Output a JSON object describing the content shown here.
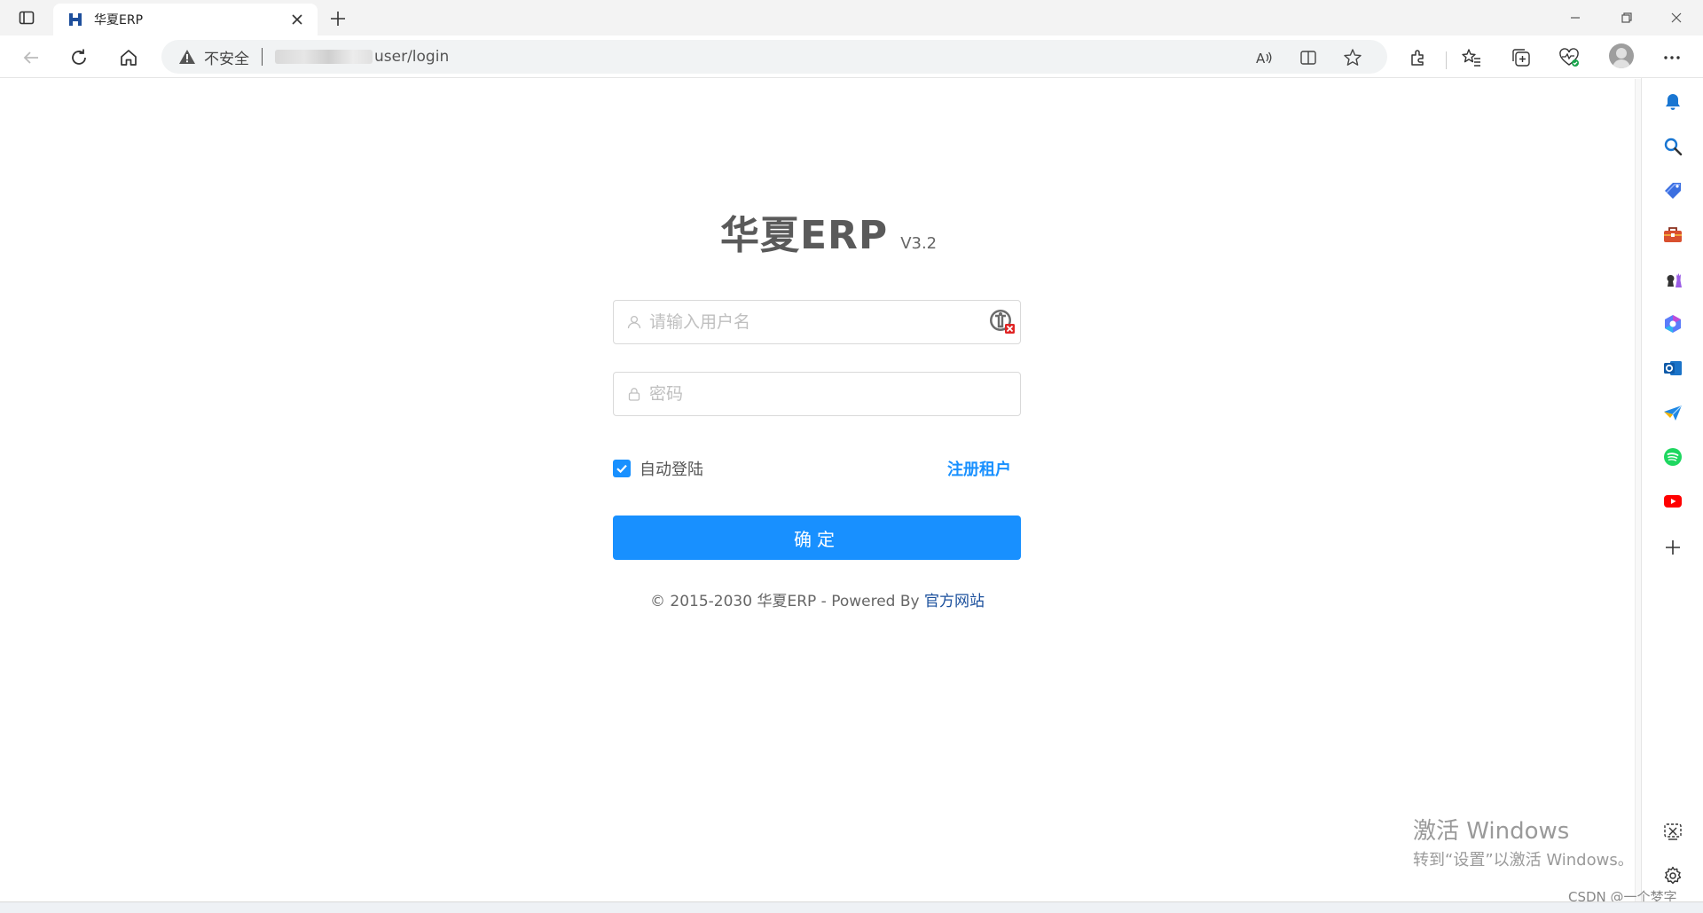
{
  "browser": {
    "tab_title": "华夏ERP",
    "address": {
      "security_label": "不安全",
      "url_path": "user/login"
    }
  },
  "login": {
    "brand_name": "华夏ERP",
    "version": "V3.2",
    "username_placeholder": "请输入用户名",
    "password_placeholder": "密码",
    "remember_label": "自动登陆",
    "remember_checked": true,
    "register_link": "注册租户",
    "submit_label": "确定",
    "footer_prefix": "© 2015-2030 华夏ERP - Powered By ",
    "footer_link": "官方网站"
  },
  "watermark": {
    "line1": "激活 Windows",
    "line2": "转到“设置”以激活 Windows。"
  },
  "credit": "CSDN @一个梦字",
  "colors": {
    "primary": "#1890ff",
    "link": "#1a4f9c",
    "brand_text": "#5a5a5a"
  }
}
